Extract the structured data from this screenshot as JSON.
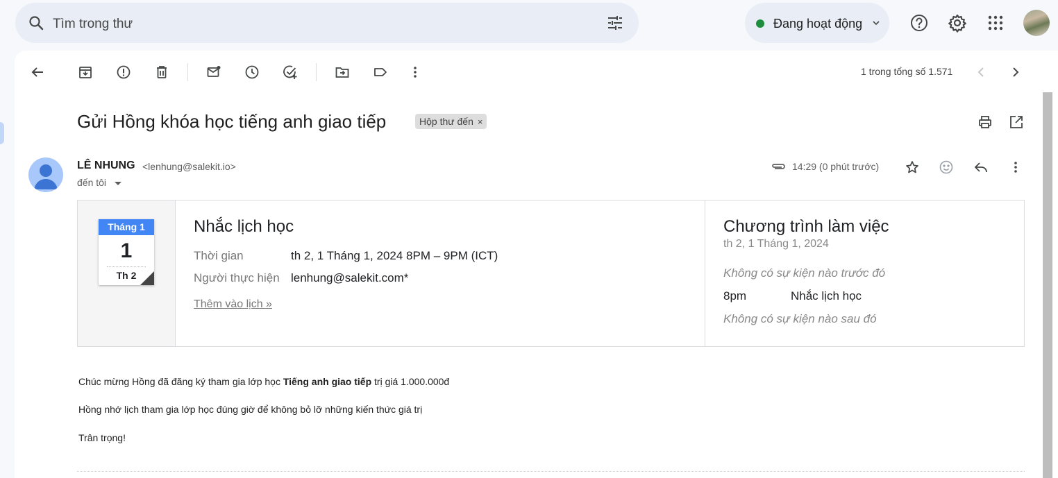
{
  "search": {
    "placeholder": "Tìm trong thư"
  },
  "status": {
    "label": "Đang hoạt động",
    "color": "#1e8e3e"
  },
  "icons": {
    "search": "search-icon",
    "tune": "tune-icon",
    "help": "help-icon",
    "settings": "gear-icon",
    "apps": "apps-grid-icon",
    "back": "arrow-back-icon",
    "archive": "archive-icon",
    "spam": "report-spam-icon",
    "delete": "trash-icon",
    "unread": "mark-unread-icon",
    "snooze": "clock-icon",
    "task": "add-task-icon",
    "move": "move-to-icon",
    "label": "label-icon",
    "more": "more-vert-icon",
    "print": "print-icon",
    "newwindow": "open-new-window-icon",
    "attach": "paperclip-icon",
    "star": "star-icon",
    "emoji": "emoji-icon",
    "reply": "reply-icon"
  },
  "toolbar": {
    "pager": "1 trong tổng số 1.571"
  },
  "email": {
    "subject": "Gửi Hồng khóa học tiếng anh giao tiếp",
    "label": "Hộp thư đến",
    "label_close": "×",
    "sender_name": "LÊ NHUNG",
    "sender_email": "<lenhung@salekit.io>",
    "to": "đến tôi",
    "time": "14:29 (0 phút trước)"
  },
  "invite": {
    "cal_month": "Tháng 1",
    "cal_day": "1",
    "cal_weekday": "Th 2",
    "title": "Nhắc lịch học",
    "time_label": "Thời gian",
    "time_value": "th 2, 1 Tháng 1, 2024 8PM – 9PM (ICT)",
    "organizer_label": "Người thực hiện",
    "organizer_value": "lenhung@salekit.com*",
    "add_link": "Thêm vào lịch »",
    "agenda_title": "Chương trình làm việc",
    "agenda_date": "th 2, 1 Tháng 1, 2024",
    "agenda_none_before": "Không có sự kiện nào trước đó",
    "agenda_time": "8pm",
    "agenda_event": "Nhắc lịch học",
    "agenda_none_after": "Không có sự kiện nào sau đó"
  },
  "body": {
    "line1_pre": "Chúc mừng Hồng đã đăng ký tham gia lớp học ",
    "line1_bold": "Tiếng anh giao tiếp",
    "line1_post": " trị giá 1.000.000đ",
    "line2": "Hồng nhớ lịch tham gia lớp học đúng giờ để không bỏ lỡ những kiến thức giá trị",
    "line3": "Trân trọng!"
  }
}
